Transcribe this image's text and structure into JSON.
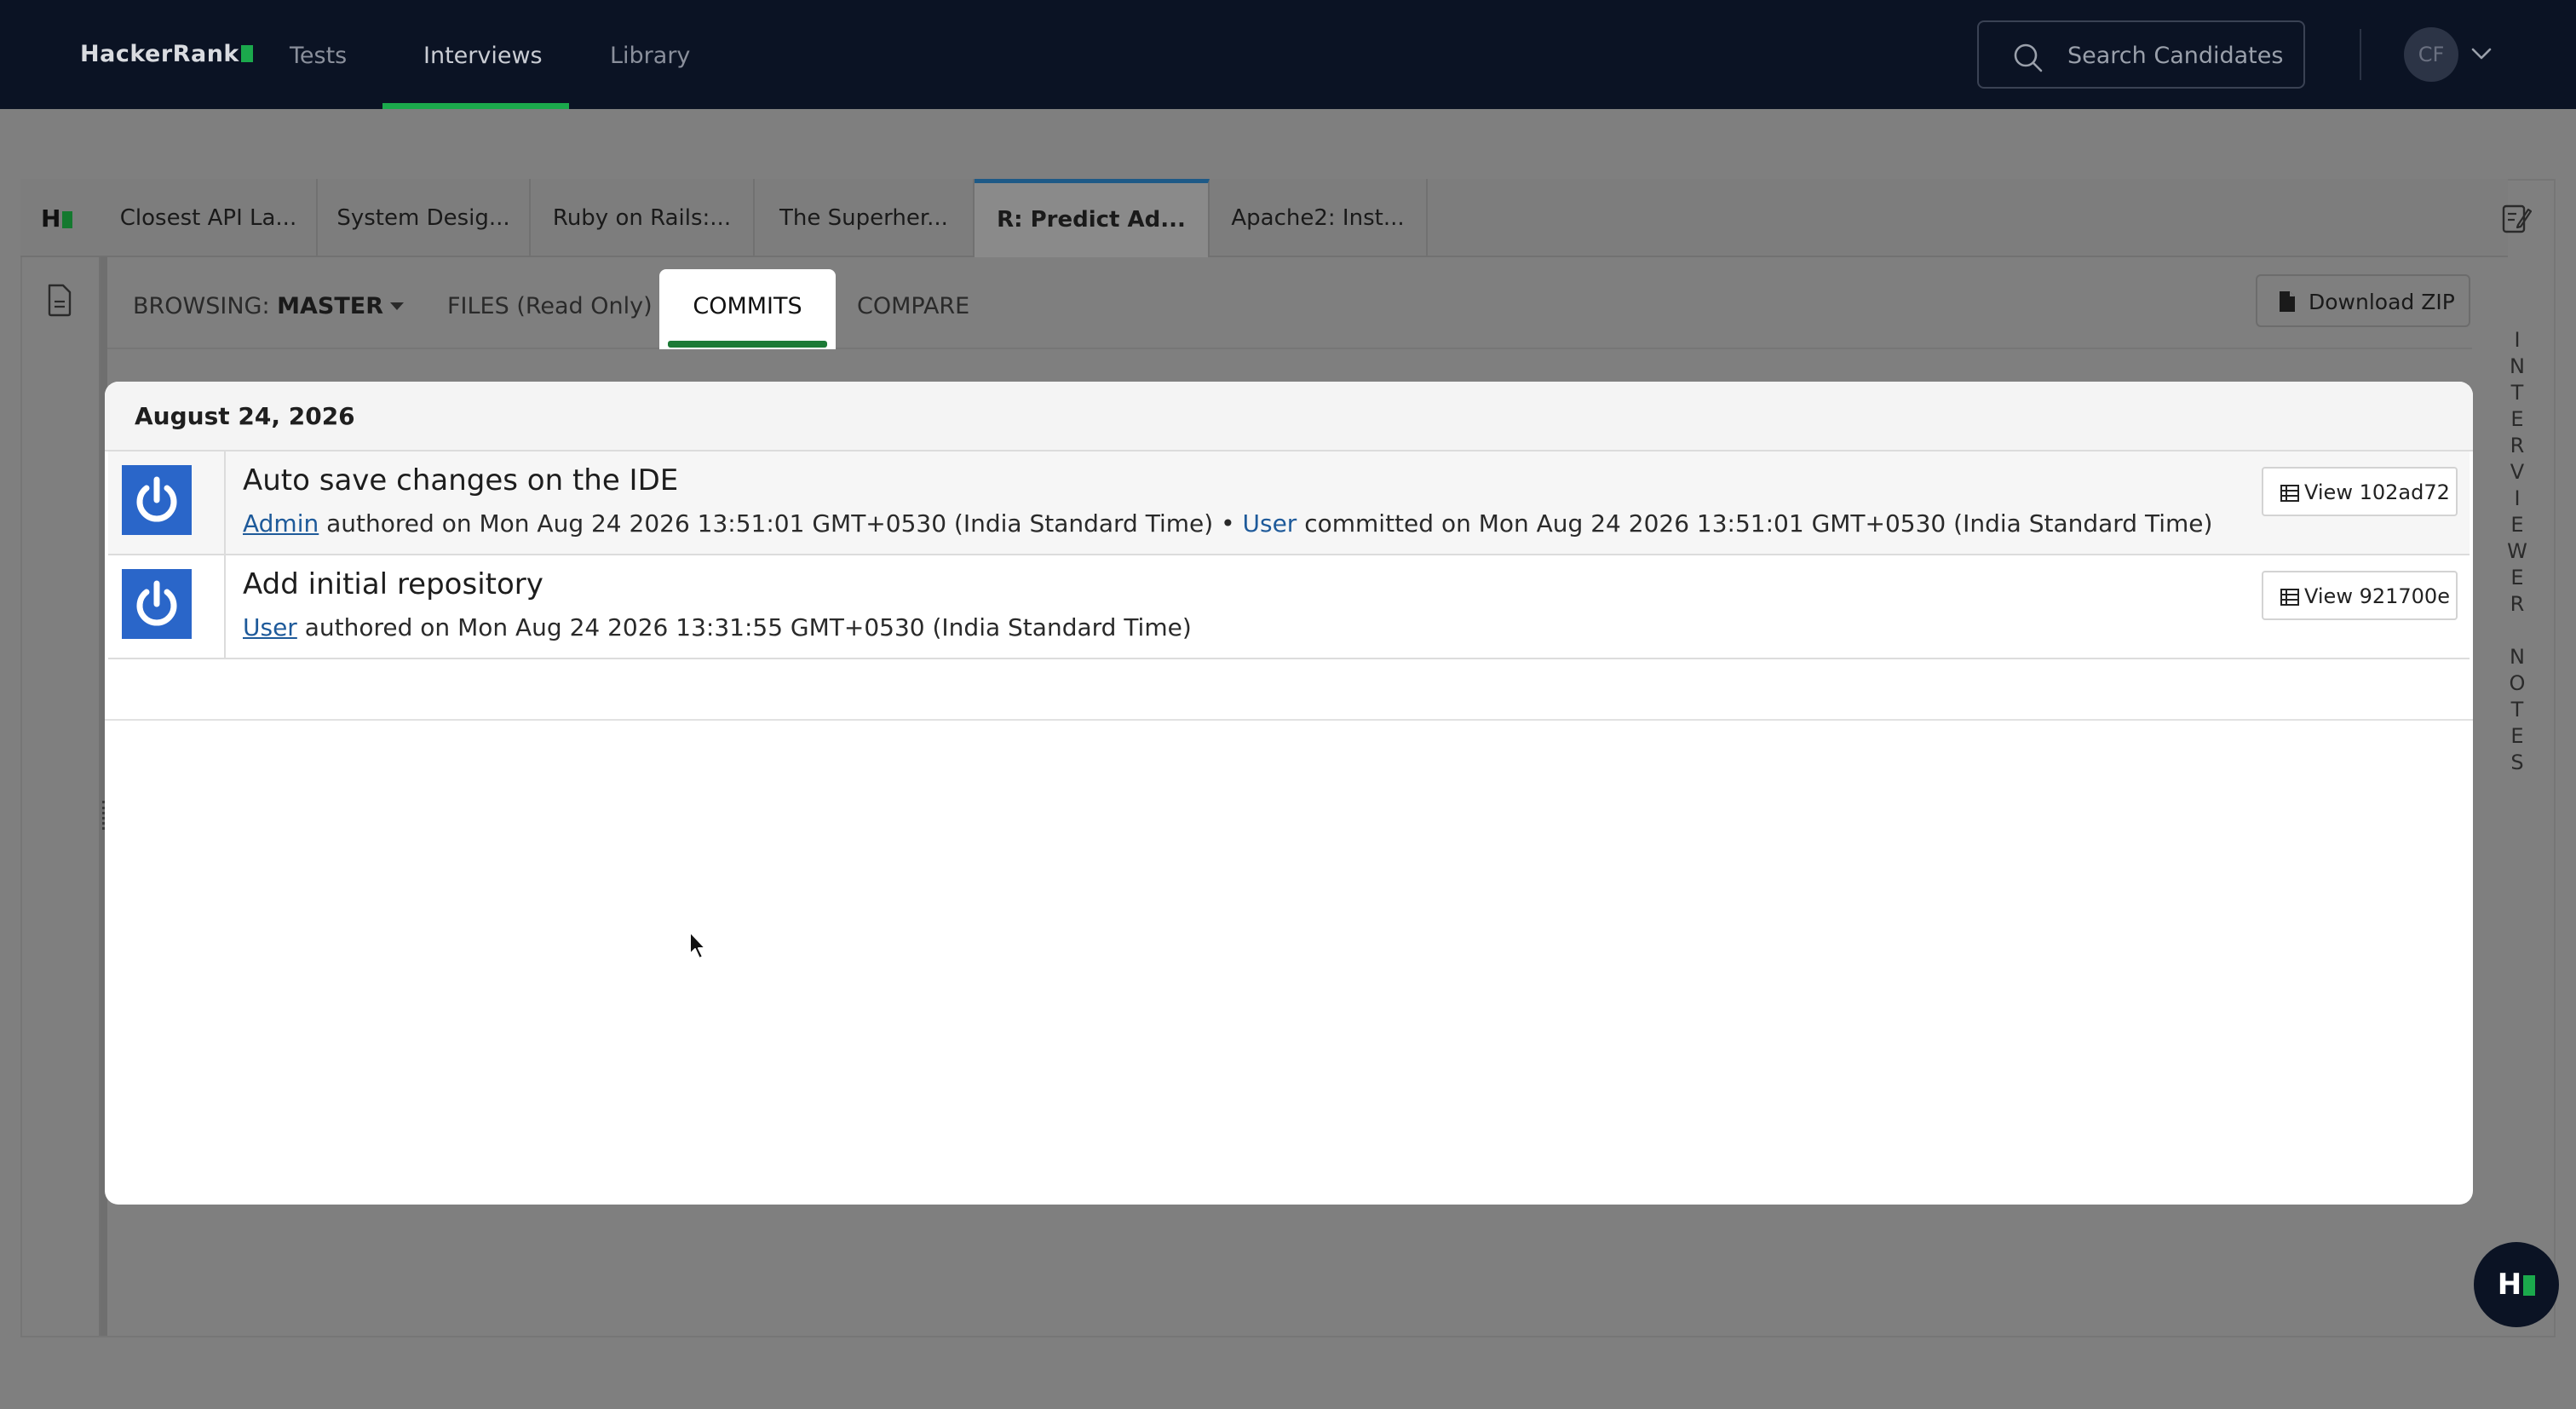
{
  "topnav": {
    "logo": "HackerRank",
    "links": [
      "Tests",
      "Interviews",
      "Library"
    ],
    "active_link": "Interviews",
    "search_placeholder": "Search Candidates",
    "avatar_initials": "CF",
    "icons": [
      "search-icon",
      "chevron-down-icon"
    ],
    "accent_color": "#1ba94c"
  },
  "tabs": [
    {
      "label": "Closest API La..."
    },
    {
      "label": "System Desig..."
    },
    {
      "label": "Ruby on Rails:..."
    },
    {
      "label": "The Superher..."
    },
    {
      "label": "R: Predict Ad..."
    },
    {
      "label": "Apache2: Inst..."
    }
  ],
  "active_tab": "R: Predict Ad...",
  "side_notes_label": "INTERVIEWER NOTES",
  "subnav": {
    "browsing_prefix": "BROWSING: ",
    "branch": "MASTER",
    "files_label": "FILES (Read Only)",
    "commits_label": "COMMITS",
    "compare_label": "COMPARE",
    "download_label": "Download ZIP"
  },
  "commits": {
    "date_heading": "August 24, 2026",
    "items": [
      {
        "message": "Auto save changes on the IDE",
        "author": "Admin",
        "authored_text": " authored on Mon Aug 24 2026 13:51:01 GMT+0530 (India Standard Time) • ",
        "committer": "User",
        "committed_text": " committed on Mon Aug 24 2026 13:51:01 GMT+0530 (India Standard Time)",
        "view_label": "View 102ad72"
      },
      {
        "message": "Add initial repository",
        "author": "User",
        "authored_text": " authored on Mon Aug 24 2026 13:31:55 GMT+0530 (India Standard Time)",
        "view_label": "View 921700e"
      }
    ]
  },
  "fab_logo": "H"
}
